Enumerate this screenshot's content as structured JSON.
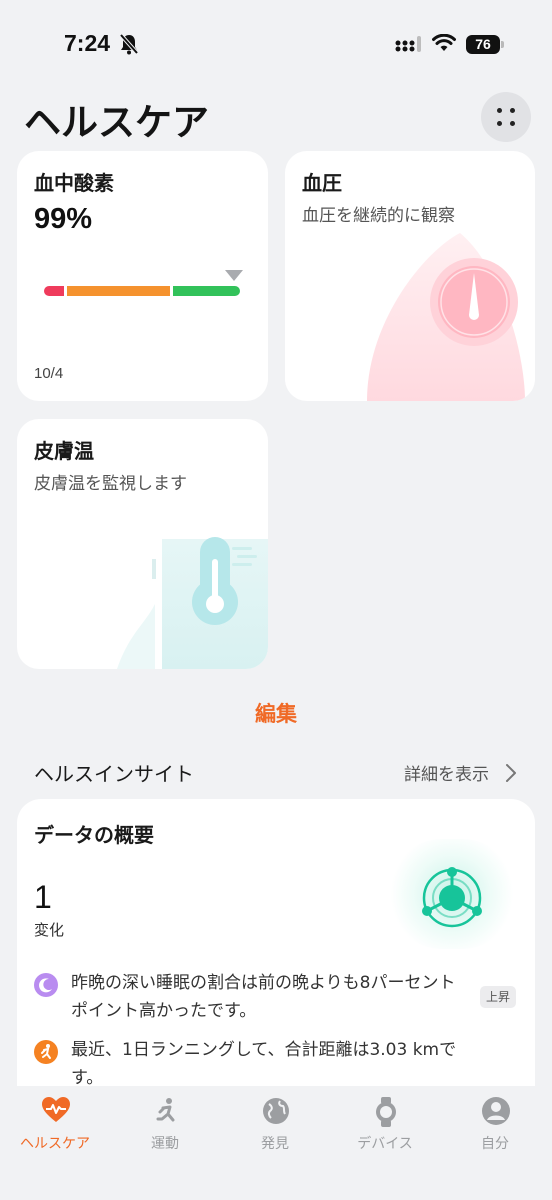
{
  "status": {
    "time": "7:24",
    "battery": "76"
  },
  "header": {
    "title": "ヘルスケア"
  },
  "cards": {
    "spo2": {
      "title": "血中酸素",
      "value": "99%",
      "date": "10/4"
    },
    "blood_pressure": {
      "title": "血圧",
      "subtitle": "血圧を継続的に観察"
    },
    "skin_temp": {
      "title": "皮膚温",
      "subtitle": "皮膚温を監視します"
    }
  },
  "edit_label": "編集",
  "insights": {
    "section_title": "ヘルスインサイト",
    "more_label": "詳細を表示",
    "overview": {
      "title": "データの概要",
      "count": "1",
      "count_label": "変化",
      "items": [
        {
          "icon": "moon-sleep-icon",
          "text": "昨晩の深い睡眠の割合は前の晩よりも8パーセントポイント高かったです。",
          "badge": "上昇"
        },
        {
          "icon": "running-icon",
          "text": "最近、1日ランニングして、合計距離は3.03 kmです。"
        }
      ]
    }
  },
  "tabs": [
    {
      "label": "ヘルスケア",
      "icon": "heart-pulse-icon",
      "active": true
    },
    {
      "label": "運動",
      "icon": "runner-icon",
      "active": false
    },
    {
      "label": "発見",
      "icon": "globe-icon",
      "active": false
    },
    {
      "label": "デバイス",
      "icon": "watch-icon",
      "active": false
    },
    {
      "label": "自分",
      "icon": "profile-icon",
      "active": false
    }
  ],
  "colors": {
    "accent": "#f06a26",
    "spo2_low": "#ef3b5c",
    "spo2_mid": "#f5922e",
    "spo2_high": "#32c25a",
    "insight_teal": "#17c49a"
  }
}
